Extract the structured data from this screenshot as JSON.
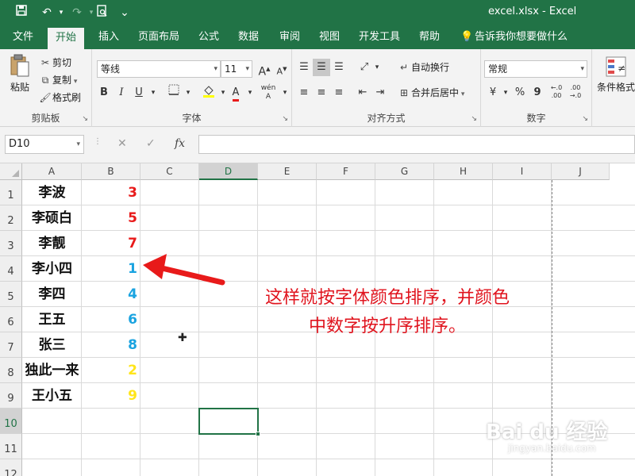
{
  "titlebar": {
    "title": "excel.xlsx - Excel",
    "customize_glyph": "⌄"
  },
  "tabs": [
    "文件",
    "开始",
    "插入",
    "页面布局",
    "公式",
    "数据",
    "审阅",
    "视图",
    "开发工具",
    "帮助"
  ],
  "tell_me": "告诉我你想要做什么",
  "ribbon": {
    "clipboard": {
      "paste": "粘贴",
      "cut": "剪切",
      "copy": "复制",
      "format_painter": "格式刷",
      "label": "剪贴板"
    },
    "font": {
      "family": "等线",
      "size": "11",
      "label": "字体",
      "bold": "B",
      "italic": "I",
      "underline": "U",
      "grow": "A",
      "shrink": "A",
      "color_letter": "A",
      "wen": "wén"
    },
    "alignment": {
      "wrap_text": "自动换行",
      "merge_center": "合并后居中",
      "label": "对齐方式"
    },
    "number": {
      "format": "常规",
      "label": "数字",
      "percent": "%",
      "comma": "9"
    },
    "styles": {
      "conditional_format": "条件格式"
    }
  },
  "formula_bar": {
    "name_box": "D10",
    "fx": "fx",
    "value": ""
  },
  "columns": [
    "A",
    "B",
    "C",
    "D",
    "E",
    "F",
    "G",
    "H",
    "I",
    "J"
  ],
  "rows": [
    "1",
    "2",
    "3",
    "4",
    "5",
    "6",
    "7",
    "8",
    "9",
    "10",
    "11",
    "12"
  ],
  "active_column": "D",
  "active_row": "10",
  "table": [
    {
      "name": "李波",
      "value": "3",
      "color": "#e81a1a"
    },
    {
      "name": "李硕白",
      "value": "5",
      "color": "#e81a1a"
    },
    {
      "name": "李靓",
      "value": "7",
      "color": "#e81a1a"
    },
    {
      "name": "李小四",
      "value": "1",
      "color": "#1aa3e0"
    },
    {
      "name": "李四",
      "value": "4",
      "color": "#1aa3e0"
    },
    {
      "name": "王五",
      "value": "6",
      "color": "#1aa3e0"
    },
    {
      "name": "张三",
      "value": "8",
      "color": "#1aa3e0"
    },
    {
      "name": "独此一来",
      "value": "2",
      "color": "#ffe51a"
    },
    {
      "name": "王小五",
      "value": "9",
      "color": "#ffe51a"
    }
  ],
  "annotation": {
    "line1": "这样就按字体颜色排序，并颜色",
    "line2": "中数字按升序排序。",
    "color": "#e0141e"
  },
  "watermark": {
    "text": "Bai du 经验",
    "url": "jingyan.baidu.com"
  },
  "colors": {
    "accent": "#217346",
    "ribbon_bg": "#f3f3f3"
  }
}
